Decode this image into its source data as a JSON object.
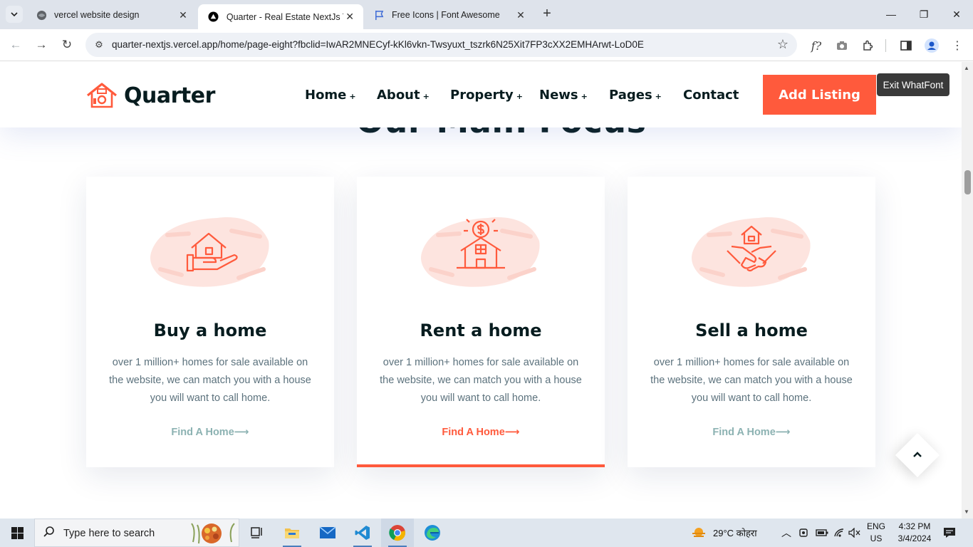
{
  "browser": {
    "tabs": [
      {
        "title": "vercel website design",
        "active": false
      },
      {
        "title": "Quarter - Real Estate NextJs Ten",
        "active": true
      },
      {
        "title": "Free Icons | Font Awesome",
        "active": false
      }
    ],
    "new_tab": "+",
    "url": "quarter-nextjs.vercel.app/home/page-eight?fbclid=IwAR2MNECyf-kKl6vkn-Twsyuxt_tszrk6N25Xit7FP3cXX2EMHArwt-LoD0E",
    "whatfont_ext": "f?"
  },
  "site": {
    "brand": "Quarter",
    "nav": [
      {
        "label": "Home",
        "plus": "+"
      },
      {
        "label": "About",
        "plus": "+"
      },
      {
        "label": "Property",
        "plus": "+"
      },
      {
        "label": "News",
        "plus": "+"
      },
      {
        "label": "Pages",
        "plus": "+"
      },
      {
        "label": "Contact",
        "plus": ""
      }
    ],
    "cta": "Add Listing",
    "whatfont_tooltip": "Exit WhatFont",
    "section_title_partial": "Our Main Focus",
    "accent": "#ff5a3c",
    "dark": "#071c1f",
    "cards": [
      {
        "title": "Buy a home",
        "desc": "over 1 million+ homes for sale available on the website, we can match you with a house you will want to call home.",
        "link": "Find A Home",
        "icon": "house-in-hand-icon",
        "active": false
      },
      {
        "title": "Rent a home",
        "desc": "over 1 million+ homes for sale available on the website, we can match you with a house you will want to call home.",
        "link": "Find A Home",
        "icon": "house-dollar-icon",
        "active": true
      },
      {
        "title": "Sell a home",
        "desc": "over 1 million+ homes for sale available on the website, we can match you with a house you will want to call home.",
        "link": "Find A Home",
        "icon": "handshake-house-icon",
        "active": false
      }
    ],
    "link_arrow": "⟶"
  },
  "taskbar": {
    "search_placeholder": "Type here to search",
    "weather": "29°C  कोहरा",
    "lang_1": "ENG",
    "lang_2": "US",
    "time": "4:32 PM",
    "date": "3/4/2024"
  }
}
